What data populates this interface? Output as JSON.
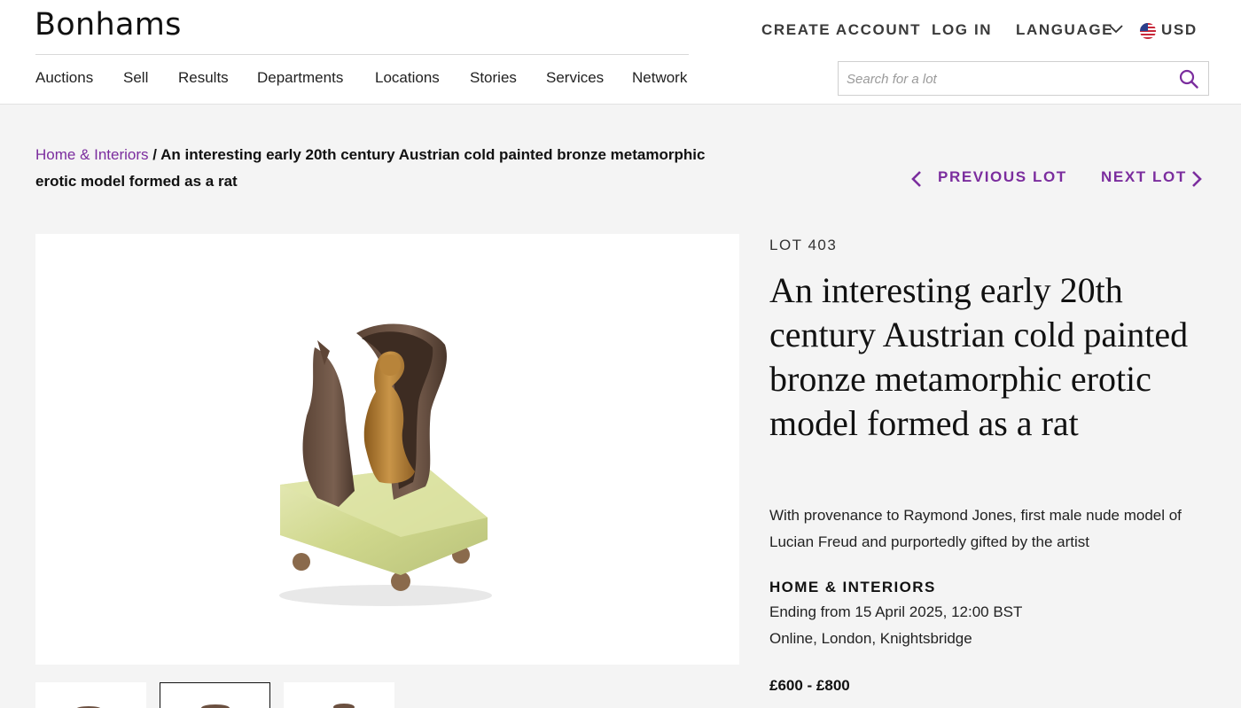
{
  "header": {
    "logo": "Bonhams",
    "create_account": "CREATE ACCOUNT",
    "log_in": "LOG IN",
    "language": "LANGUAGE",
    "currency": "USD",
    "nav": [
      "Auctions",
      "Sell",
      "Results",
      "Departments",
      "Locations",
      "Stories",
      "Services",
      "Network"
    ],
    "search_placeholder": "Search for a lot"
  },
  "breadcrumb": {
    "parent": "Home & Interiors",
    "separator": " / ",
    "current": "An interesting early 20th century Austrian cold painted bronze metamorphic erotic model formed as a rat"
  },
  "lot_nav": {
    "previous": "PREVIOUS LOT",
    "next": "NEXT LOT"
  },
  "lot": {
    "number": "LOT 403",
    "title": "An interesting early 20th century Austrian cold painted bronze metamorphic erotic model formed as a rat",
    "description": "With provenance to Raymond Jones, first male nude model of Lucian Freud and purportedly gifted by the artist",
    "department": "HOME & INTERIORS",
    "ending": "Ending from 15 April 2025, 12:00 BST",
    "venue": "Online, London, Knightsbridge",
    "estimate": "£600 - £800"
  },
  "colors": {
    "accent": "#7b2d9e",
    "background": "#f4f4f4"
  },
  "icons": [
    "chevron-down-icon",
    "us-flag-icon",
    "search-icon",
    "chevron-left-icon",
    "chevron-right-icon"
  ]
}
